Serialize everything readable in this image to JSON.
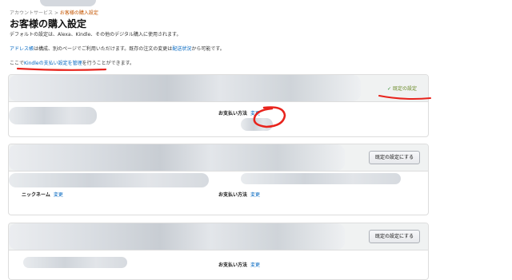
{
  "breadcrumb": {
    "parent": "アカウントサービス",
    "separator": ">",
    "current": "お客様の購入設定"
  },
  "page_title": "お客様の購入設定",
  "intro": {
    "line1": "デフォルトの設定は、Alexa、Kindle、その他のデジタル購入に使用されます。",
    "line2_link": "アドレス帳",
    "line2_mid": "は構成、別のページでご利用いただけます。既存の注文の変更は",
    "line2_link2": "配送状況",
    "line2_end": "から可能です。",
    "line3_pre": "ここで",
    "line3_link": "Kindleの支払い設定を管理",
    "line3_post": "を行うことができます。"
  },
  "cards": [
    {
      "default_label": "既定の設定",
      "payment_label": "お支払い方法",
      "payment_action": "変更"
    },
    {
      "button_label": "既定の設定にする",
      "nickname_label": "ニックネーム",
      "nickname_action": "変更",
      "payment_label": "お支払い方法",
      "payment_action": "変更"
    },
    {
      "button_label": "既定の設定にする",
      "payment_label": "お支払い方法",
      "payment_action": "変更"
    }
  ],
  "colors": {
    "link": "#0066c0",
    "breadcrumb_current": "#c45500",
    "annotation": "#e8231c",
    "default_badge": "#6a8a26"
  }
}
